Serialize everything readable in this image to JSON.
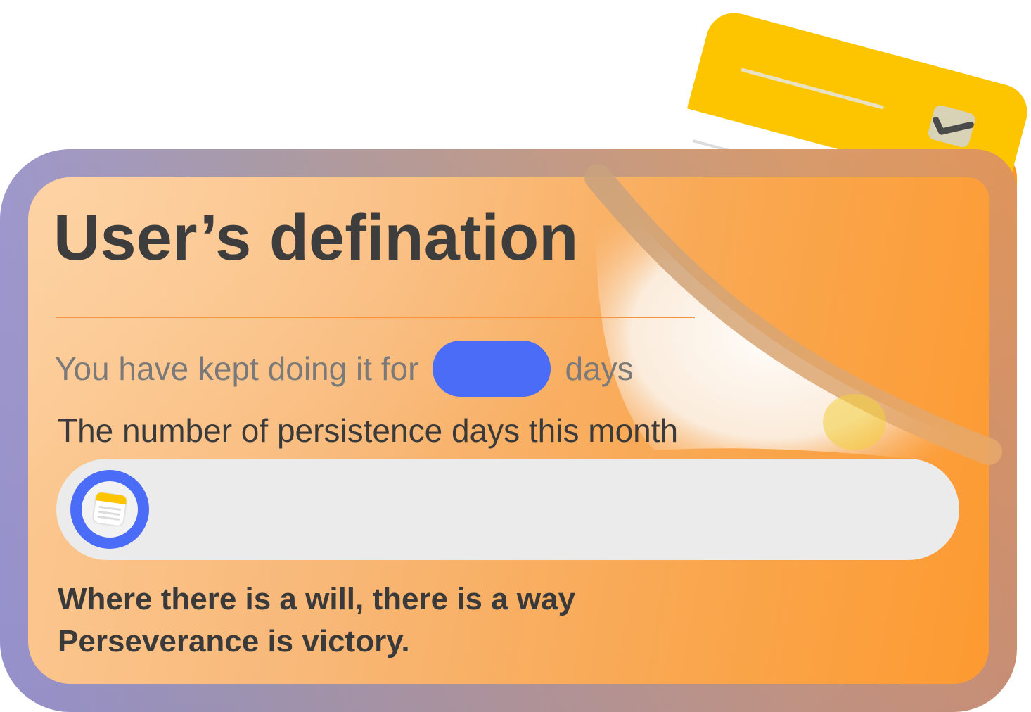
{
  "card": {
    "title": "User’s defination",
    "kept_prefix": "You have kept doing it for",
    "kept_days_value": "",
    "kept_suffix": "days",
    "month_label": "The number of persistence days this month",
    "motto_line1": "Where there is a will, there is a way",
    "motto_line2": "Perseverance is victory."
  },
  "progress": {
    "fraction": 0.0,
    "thumb_icon": "notepad-icon"
  },
  "illustration": {
    "icon": "notepad-with-pencil-icon"
  },
  "colors": {
    "accent_blue": "#4a6cf7",
    "card_orange": "#fd9a30",
    "notepad_yellow": "#fdc500",
    "title_text": "#3d3d3d"
  }
}
